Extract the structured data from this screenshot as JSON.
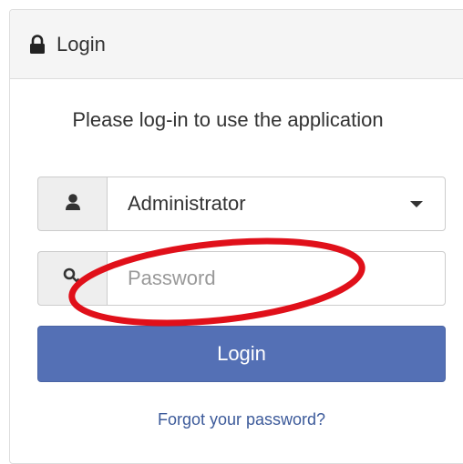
{
  "panel": {
    "title": "Login",
    "title_icon": "lock-icon"
  },
  "prompt": "Please log-in to use the application",
  "user_select": {
    "icon": "user-icon",
    "selected": "Administrator"
  },
  "password": {
    "icon": "key-icon",
    "placeholder": "Password",
    "value": ""
  },
  "login_button": {
    "label": "Login",
    "color": "#5470b5"
  },
  "forgot_link": "Forgot your password?",
  "annotation": {
    "shape": "ellipse",
    "color": "#e0101a",
    "target": "password-input"
  }
}
